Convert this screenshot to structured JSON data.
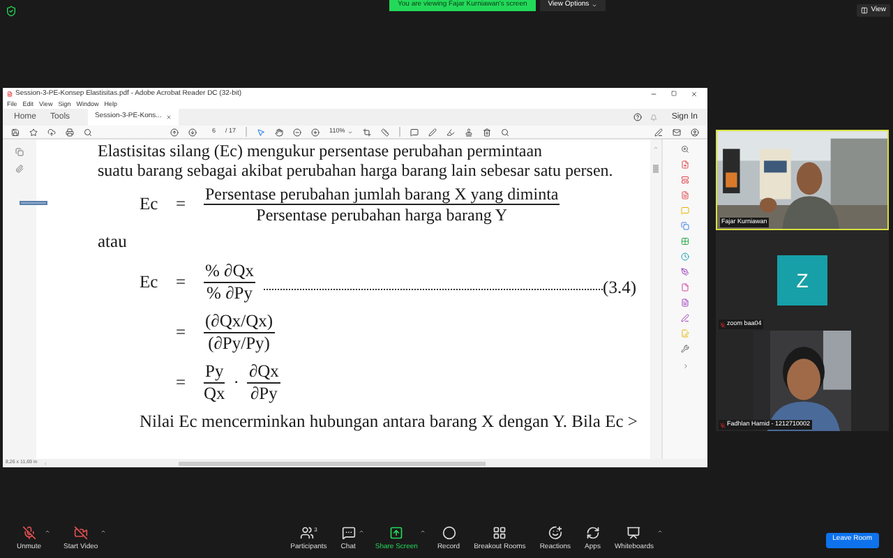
{
  "banner": {
    "text": "You are viewing Fajar Kurniawan's screen",
    "view_options": "View Options"
  },
  "view_button": "View",
  "acrobat": {
    "title": "Session-3-PE-Konsep Elastisitas.pdf - Adobe Acrobat Reader DC (32-bit)",
    "menu": [
      "File",
      "Edit",
      "View",
      "Sign",
      "Window",
      "Help"
    ],
    "tabs": [
      {
        "label": "Home",
        "selected": false
      },
      {
        "label": "Tools",
        "selected": false
      },
      {
        "label": "Session-3-PE-Kons...",
        "selected": true
      }
    ],
    "sign_in": "Sign In",
    "page_number": "6",
    "page_total": "/ 17",
    "zoom": "110%",
    "page_size": "8,26 x 11,69 in"
  },
  "document": {
    "top_line": "Elastisitas silang (Ec) mengukur persentase perubahan permintaan",
    "line": "suatu barang sebagai akibat perubahan harga barang lain sebesar satu persen.",
    "eq1": {
      "lhs": "Ec",
      "eq": "=",
      "num": "Persentase perubahan jumlah barang X yang diminta",
      "den": "Persentase perubahan harga barang Y"
    },
    "atau": "atau",
    "eq2": {
      "lhs": "Ec",
      "eq": "=",
      "num": "% ∂Qx",
      "den": "% ∂Py",
      "ref": "(3.4)"
    },
    "eq3": {
      "eq": "=",
      "num": "(∂Qx/Qx)",
      "den": "(∂Py/Py)"
    },
    "eq4": {
      "eq": "=",
      "num1": "Py",
      "den1": "Qx",
      "dot": "·",
      "num2": "∂Qx",
      "den2": "∂Py"
    },
    "last_line": "Nilai Ec mencerminkan hubungan antara barang X dengan Y. Bila Ec >"
  },
  "participants": [
    {
      "name": "Fajar Kurniawan",
      "kind": "video",
      "speaking": true,
      "muted": false
    },
    {
      "name": "zoom baa04",
      "kind": "avatar",
      "initial": "Z",
      "speaking": false,
      "muted": true
    },
    {
      "name": "Fadhlan Hamid - 1212710002",
      "kind": "video",
      "speaking": false,
      "muted": true
    }
  ],
  "toolbar": [
    {
      "label": "Unmute",
      "caret": true,
      "highlighted": false
    },
    {
      "label": "Start Video",
      "caret": true,
      "highlighted": false
    },
    {
      "label": "Participants",
      "count": "3",
      "caret": false,
      "highlighted": false
    },
    {
      "label": "Chat",
      "caret": true,
      "highlighted": false
    },
    {
      "label": "Share Screen",
      "caret": true,
      "highlighted": true
    },
    {
      "label": "Record",
      "caret": false,
      "highlighted": false
    },
    {
      "label": "Breakout Rooms",
      "caret": false,
      "highlighted": false
    },
    {
      "label": "Reactions",
      "caret": false,
      "highlighted": false
    },
    {
      "label": "Apps",
      "caret": false,
      "highlighted": false
    },
    {
      "label": "Whiteboards",
      "caret": true,
      "highlighted": false
    }
  ],
  "leave_button": "Leave Room"
}
